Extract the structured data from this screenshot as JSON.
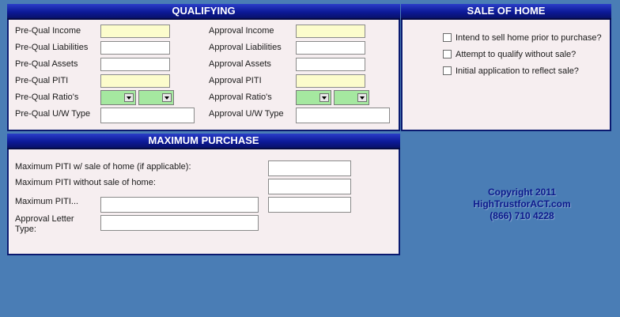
{
  "qualifying": {
    "title": "QUALIFYING",
    "prequal_income_label": "Pre-Qual Income",
    "prequal_liabilities_label": "Pre-Qual Liabilities",
    "prequal_assets_label": "Pre-Qual Assets",
    "prequal_piti_label": "Pre-Qual PITI",
    "prequal_ratios_label": "Pre-Qual Ratio's",
    "prequal_uw_type_label": "Pre-Qual U/W Type",
    "approval_income_label": "Approval Income",
    "approval_liabilities_label": "Approval Liabilities",
    "approval_assets_label": "Approval Assets",
    "approval_piti_label": "Approval PITI",
    "approval_ratios_label": "Approval Ratio's",
    "approval_uw_type_label": "Approval U/W Type",
    "prequal_income_value": "",
    "prequal_liabilities_value": "",
    "prequal_assets_value": "",
    "prequal_piti_value": "",
    "prequal_uw_type_value": "",
    "approval_income_value": "",
    "approval_liabilities_value": "",
    "approval_assets_value": "",
    "approval_piti_value": "",
    "approval_uw_type_value": ""
  },
  "sale_of_home": {
    "title": "SALE OF HOME",
    "options": [
      {
        "label": "Intend to sell home prior to purchase?",
        "checked": false
      },
      {
        "label": "Attempt to qualify without sale?",
        "checked": false
      },
      {
        "label": "Initial application to reflect sale?",
        "checked": false
      }
    ]
  },
  "maximum_purchase": {
    "title": "MAXIMUM PURCHASE",
    "max_piti_with_sale_label": "Maximum PITI w/ sale of home (if applicable):",
    "max_piti_without_sale_label": "Maximum PITI without sale of home:",
    "max_piti_label": "Maximum PITI...",
    "approval_letter_type_label": "Approval Letter Type:",
    "max_piti_with_sale_value": "",
    "max_piti_without_sale_value": "",
    "max_piti_value": "",
    "max_piti_extra_value": "",
    "approval_letter_type_value": ""
  },
  "copyright": {
    "line1": "Copyright 2011",
    "line2": "HighTrustforACT.com",
    "line3": "(866) 710 4228"
  },
  "colors": {
    "background": "#4a7db5",
    "panel": "#f6eef0",
    "header": "#0d1a9a",
    "yellow_field": "#fcfccc",
    "green_combo": "#a5e8a0"
  }
}
